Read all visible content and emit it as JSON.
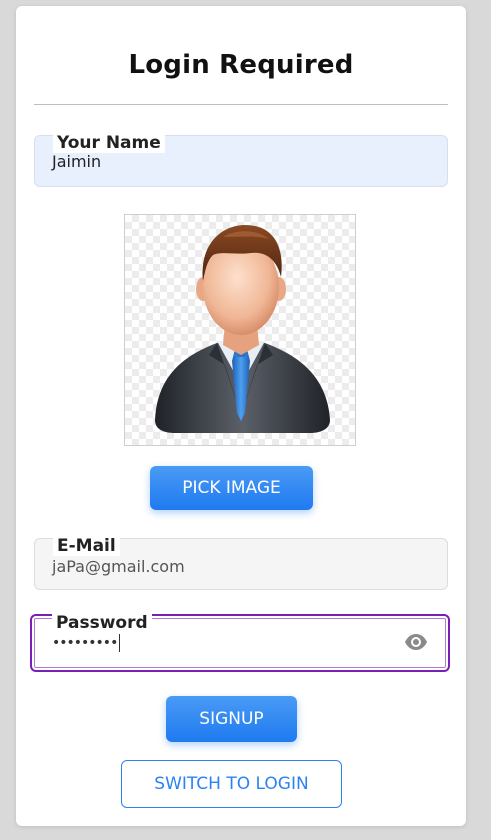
{
  "title": "Login Required",
  "name_field": {
    "label": "Your Name",
    "value": "Jaimin"
  },
  "avatar": {
    "icon": "user-avatar-icon"
  },
  "pick_image_label": "PICK IMAGE",
  "email_field": {
    "label": "E-Mail",
    "value": "jaPa@gmail.com"
  },
  "password_field": {
    "label": "Password",
    "value": "•••••••••",
    "toggle_icon": "eye-icon"
  },
  "signup_label": "SIGNUP",
  "switch_label": "SWITCH TO LOGIN",
  "colors": {
    "primary": "#1f7af0",
    "focus_border": "#7a1fb5",
    "name_field_bg": "#e8f0fe"
  }
}
